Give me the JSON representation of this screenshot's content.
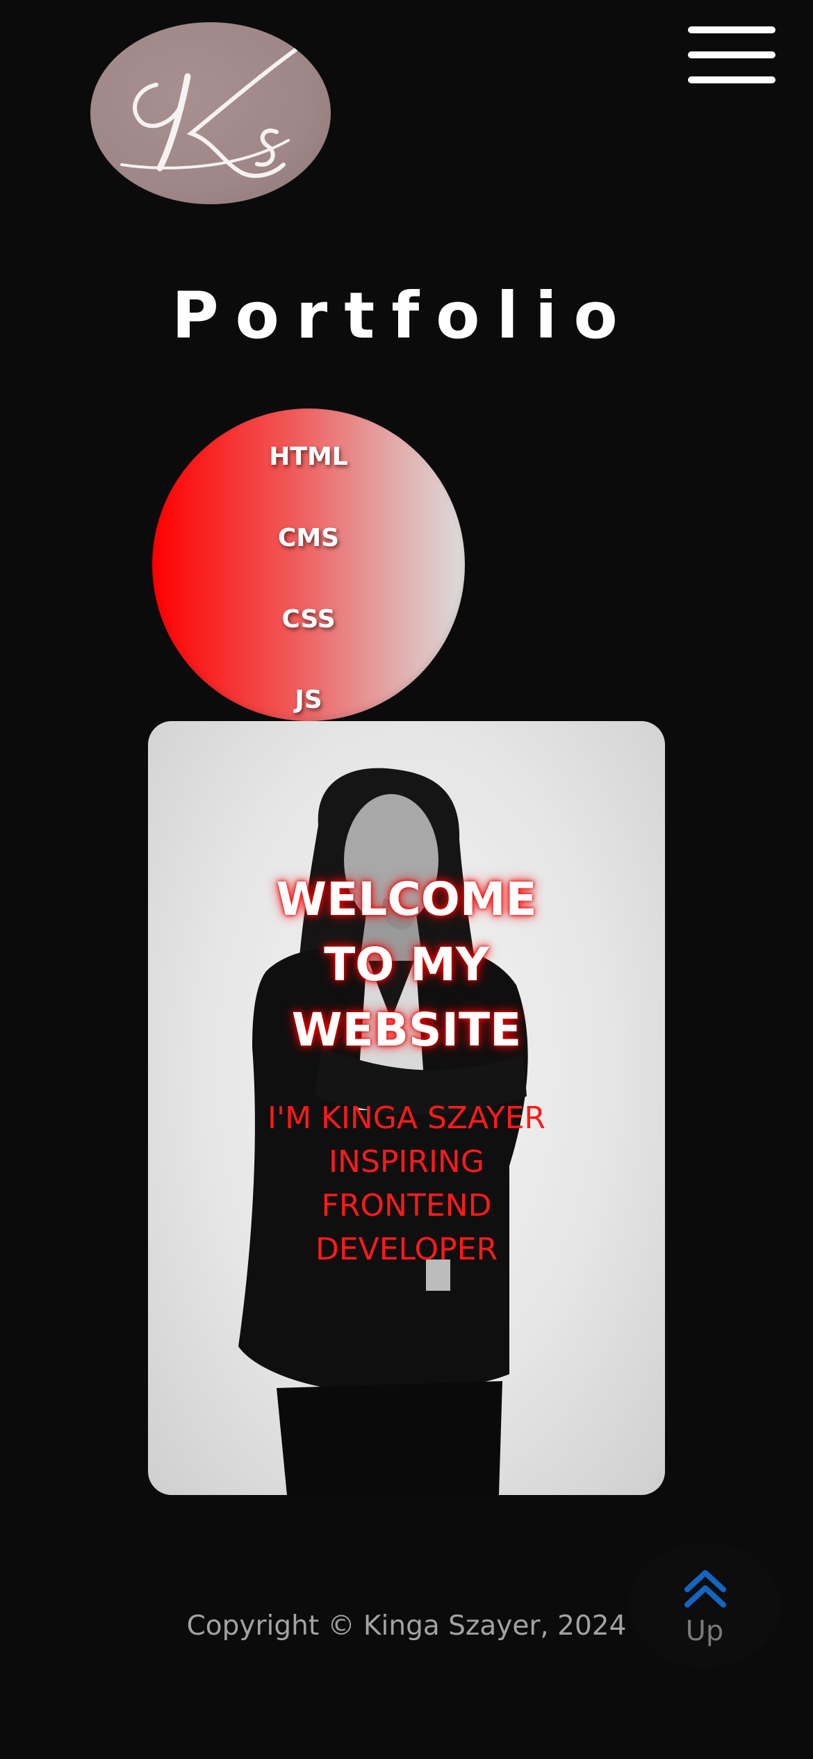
{
  "header": {
    "logo_text": "Ks",
    "menu_icon": "hamburger-menu-icon"
  },
  "main": {
    "title": "Portfolio",
    "skills": [
      "HTML",
      "CMS",
      "CSS",
      "JS"
    ],
    "hero": {
      "title": "WELCOME TO MY WEBSITE",
      "subtitle": "I'M KINGA SZAYER INSPIRING FRONTEND DEVELOPER"
    }
  },
  "footer": {
    "copyright": "Copyright © Kinga Szayer, 2024",
    "up_label": "Up",
    "up_icon": "double-chevron-up-icon"
  },
  "colors": {
    "background": "#0b0b0c",
    "accent_red": "#ff0000",
    "logo_bg": "#a08888",
    "up_icon": "#1565c0"
  }
}
